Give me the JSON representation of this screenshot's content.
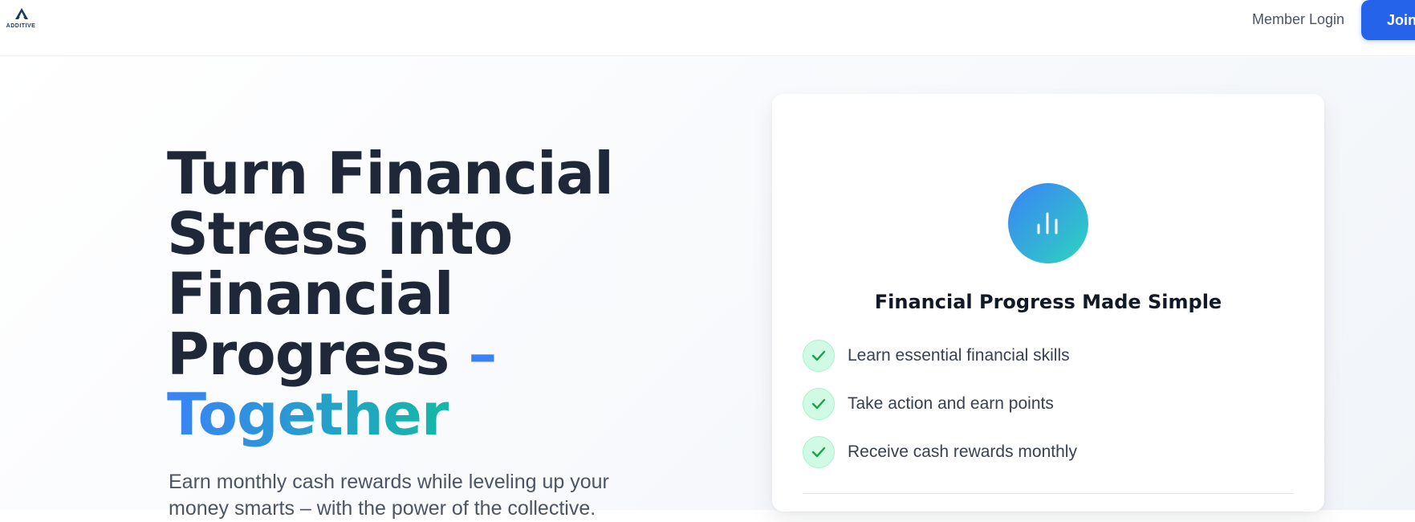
{
  "header": {
    "logo_text": "ADDITIVE",
    "login_label": "Member Login",
    "join_label": "Join"
  },
  "hero": {
    "headline_main": "Turn Financial Stress into Financial Progress",
    "headline_dash": "–",
    "headline_accent": "Together",
    "subcopy": "Earn monthly cash rewards while leveling up your money smarts – with the power of the collective."
  },
  "card": {
    "icon": "bar-chart-icon",
    "title": "Financial Progress Made Simple",
    "features": [
      {
        "label": "Learn essential financial skills",
        "icon": "check-icon"
      },
      {
        "label": "Take action and earn points",
        "icon": "check-icon"
      },
      {
        "label": "Receive cash rewards monthly",
        "icon": "check-icon"
      }
    ]
  },
  "colors": {
    "brand_blue": "#2563eb",
    "accent_blue": "#3b82f6",
    "accent_teal": "#14b8a6",
    "check_green": "#16a34a",
    "headline": "#1e2838"
  }
}
